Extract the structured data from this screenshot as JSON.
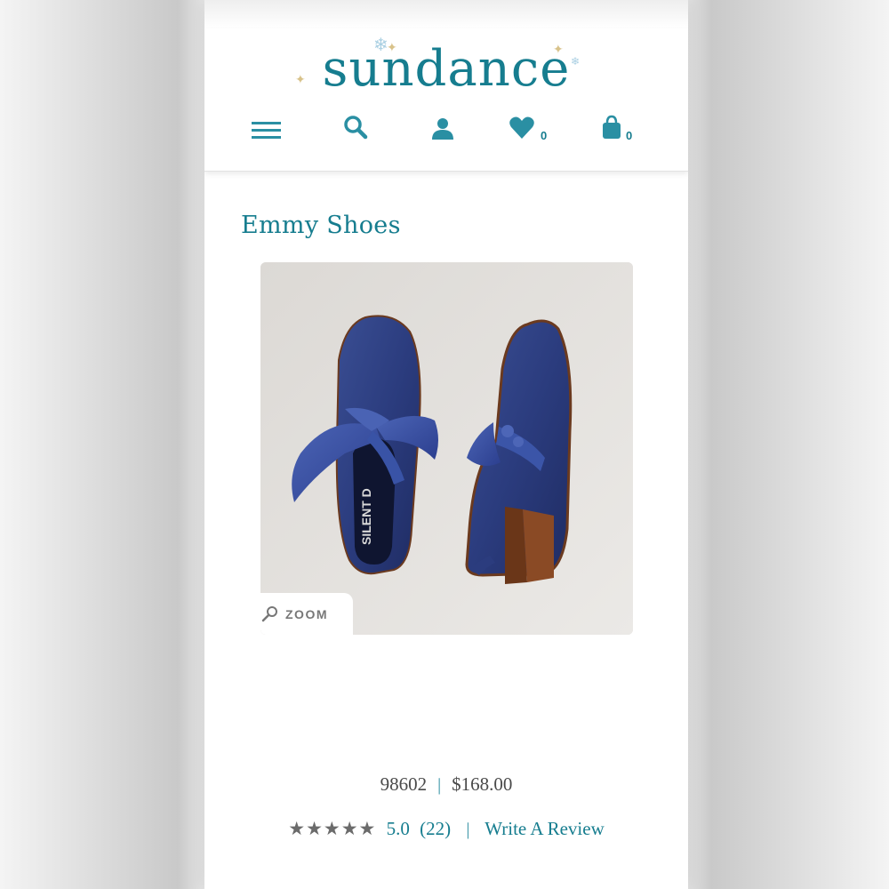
{
  "brand": {
    "logo_text": "sundance",
    "accent_color": "#167d8f"
  },
  "nav": {
    "menu_icon": "hamburger-menu-icon",
    "search_icon": "search-icon",
    "account_icon": "user-icon",
    "wishlist_icon": "heart-icon",
    "wishlist_count": "0",
    "cart_icon": "shopping-bag-icon",
    "cart_count": "0"
  },
  "product": {
    "title": "Emmy Shoes",
    "image_label": "SILENT D",
    "zoom_label": "ZOOM",
    "item_number": "98602",
    "price": "$168.00",
    "rating_stars": "★★★★★",
    "rating_value": "5.0",
    "rating_count": "(22)",
    "write_review_label": "Write A Review"
  }
}
